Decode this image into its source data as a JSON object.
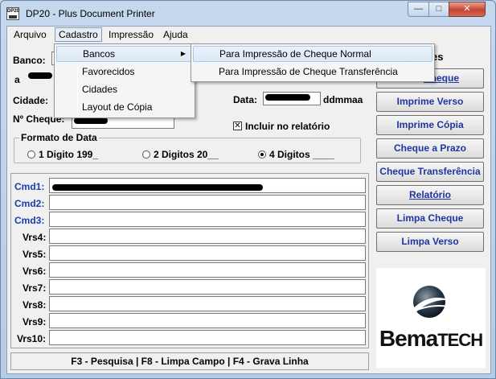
{
  "window": {
    "title": "DP20 - Plus Document Printer",
    "icon_text": "DP20",
    "minimize": "—",
    "maximize": "□",
    "close": "✕"
  },
  "menu": {
    "arquivo": "Arquivo",
    "cadastro": "Cadastro",
    "impressao": "Impressão",
    "ajuda": "Ajuda"
  },
  "cadastro_menu": {
    "bancos": "Bancos",
    "favorecidos": "Favorecidos",
    "cidades": "Cidades",
    "layout": "Layout de Cópia"
  },
  "bancos_submenu": {
    "normal": "Para Impressão de Cheque Normal",
    "transferencia": "Para Impressão de Cheque Transferência"
  },
  "form": {
    "banco_label": "Banco:",
    "a_label": "a",
    "cidade_label": "Cidade:",
    "cheque_label": "Nº Cheque:",
    "data_label": "Data:",
    "data_format": "ddmmaa",
    "incluir_label": "Incluir no relatório",
    "incluir_checked": "✕"
  },
  "date_format": {
    "legend": "Formato de Data",
    "opt1": "1 Digito 199_",
    "opt2": "2 Digitos 20__",
    "opt3": "4 Digitos ____",
    "selected": "4 Digitos ____"
  },
  "rows": {
    "cmd1": "Cmd1:",
    "cmd2": "Cmd2:",
    "cmd3": "Cmd3:",
    "vrs4": "Vrs4:",
    "vrs5": "Vrs5:",
    "vrs6": "Vrs6:",
    "vrs7": "Vrs7:",
    "vrs8": "Vrs8:",
    "vrs9": "Vrs9:",
    "vrs10": "Vrs10:"
  },
  "buttons": {
    "header_partial": "es",
    "cheque": "Cheque",
    "imprime_verso": "Imprime Verso",
    "imprime_copia": "Imprime Cópia",
    "cheque_prazo": "Cheque a Prazo",
    "cheque_transferencia": "Cheque Transferência",
    "relatorio": "Relatório",
    "limpa_cheque": "Limpa Cheque",
    "limpa_verso": "Limpa Verso"
  },
  "status": "F3 - Pesquisa  |  F8 - Limpa Campo  |  F4 - Grava Linha",
  "logo": {
    "text_big": "Bema",
    "text_small": "TECH",
    "colors": {
      "sphere": "#2a3a4a",
      "swoosh": "#ffffff"
    }
  }
}
